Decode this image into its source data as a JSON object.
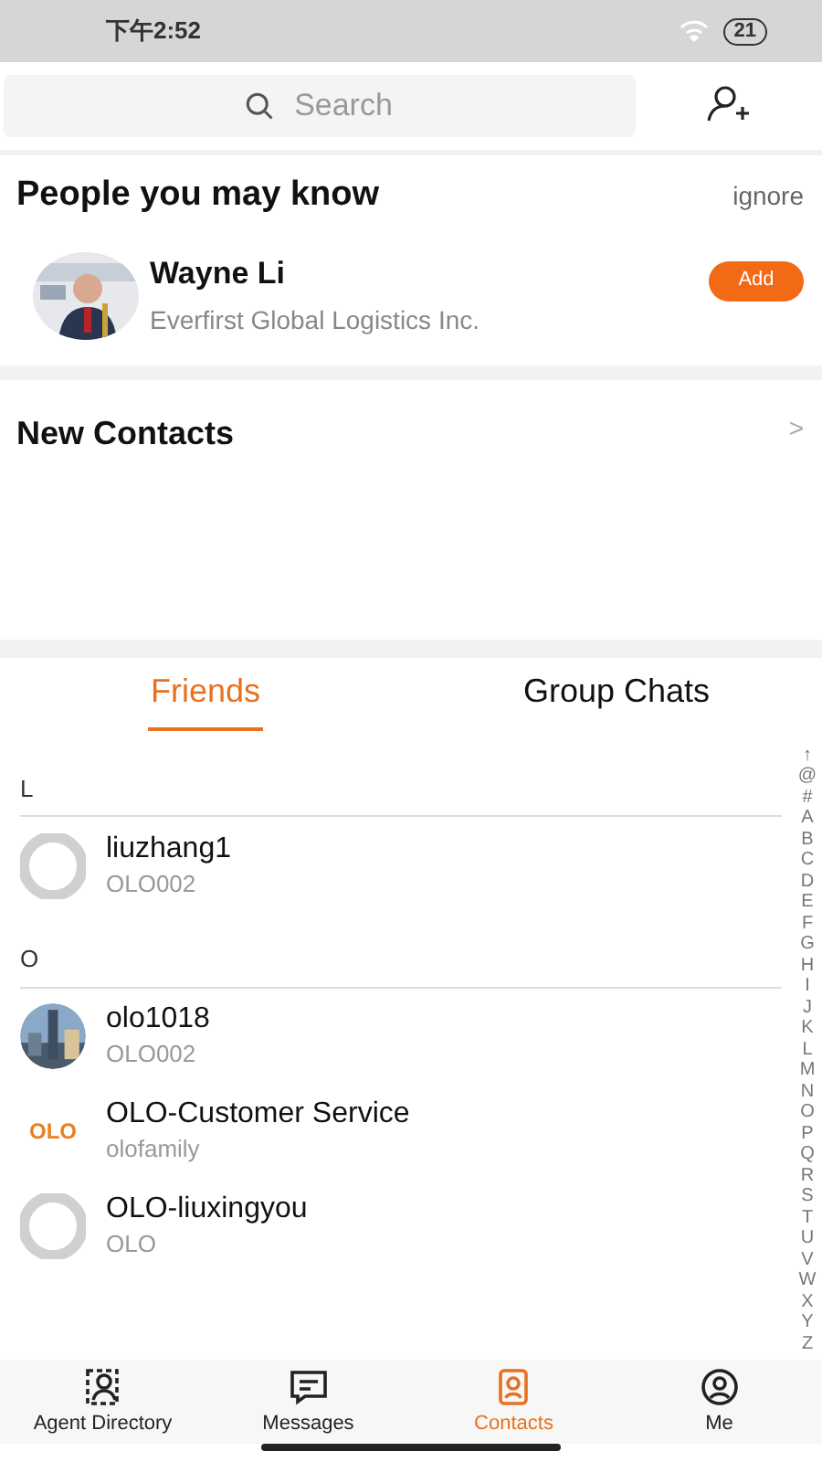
{
  "status_bar": {
    "time": "下午2:52",
    "battery": "21"
  },
  "search": {
    "placeholder": "Search"
  },
  "suggestions": {
    "title": "People you may know",
    "ignore": "ignore",
    "people": [
      {
        "name": "Wayne Li",
        "company": "Everfirst Global Logistics Inc.",
        "button": "Add"
      }
    ]
  },
  "new_contacts": {
    "title": "New Contacts",
    "chevron": ">"
  },
  "tabs": [
    {
      "label": "Friends",
      "selected": true
    },
    {
      "label": "Group Chats",
      "selected": false
    }
  ],
  "sections": [
    {
      "letter": "L",
      "contacts": [
        {
          "name": "liuzhang1",
          "sub": "OLO002",
          "kind": "default"
        }
      ]
    },
    {
      "letter": "O",
      "contacts": [
        {
          "name": "olo1018",
          "sub": "OLO002"
        },
        {
          "name": "OLO-Customer Service",
          "sub": "olofamily",
          "kind": "logo",
          "logo_text": "OLO"
        },
        {
          "name": "OLO-liuxingyou",
          "sub": "OLO",
          "kind": "default"
        }
      ]
    }
  ],
  "index": [
    "↑",
    "@",
    "#",
    "A",
    "B",
    "C",
    "D",
    "E",
    "F",
    "G",
    "H",
    "I",
    "J",
    "K",
    "L",
    "M",
    "N",
    "O",
    "P",
    "Q",
    "R",
    "S",
    "T",
    "U",
    "V",
    "W",
    "X",
    "Y",
    "Z"
  ],
  "nav": [
    {
      "label": "Agent Directory",
      "selected": false
    },
    {
      "label": "Messages",
      "selected": false
    },
    {
      "label": "Contacts",
      "selected": true
    },
    {
      "label": "Me",
      "selected": false
    }
  ]
}
